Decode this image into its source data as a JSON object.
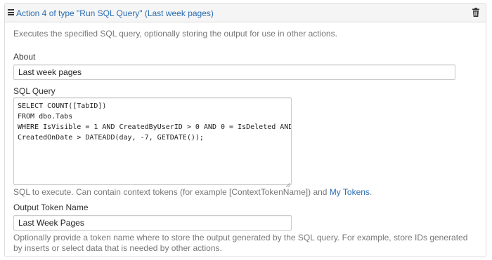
{
  "header": {
    "title": "Action 4 of type \"Run SQL Query\" (Last week pages)",
    "drag_icon": "hamburger-icon",
    "delete_icon": "trash-icon"
  },
  "description": "Executes the specified SQL query, optionally storing the output for use in other actions.",
  "about": {
    "label": "About",
    "value": "Last week pages"
  },
  "sql_query": {
    "label": "SQL Query",
    "value": "SELECT COUNT([TabID])\nFROM dbo.Tabs\nWHERE IsVisible = 1 AND CreatedByUserID > 0 AND 0 = IsDeleted AND\nCreatedOnDate > DATEADD(day, -7, GETDATE());",
    "help_prefix": "SQL to execute. Can contain context tokens (for example [ContextTokenName]) and ",
    "help_link": "My Tokens",
    "help_suffix": "."
  },
  "output_token": {
    "label": "Output Token Name",
    "value": "Last Week Pages",
    "help": "Optionally provide a token name where to store the output generated by the SQL query. For example, store IDs generated by inserts or select data that is needed by other actions."
  },
  "colors": {
    "link": "#2a6eb3",
    "muted": "#777777",
    "border": "#dddddd",
    "heading_bg": "#f5f5f5"
  }
}
